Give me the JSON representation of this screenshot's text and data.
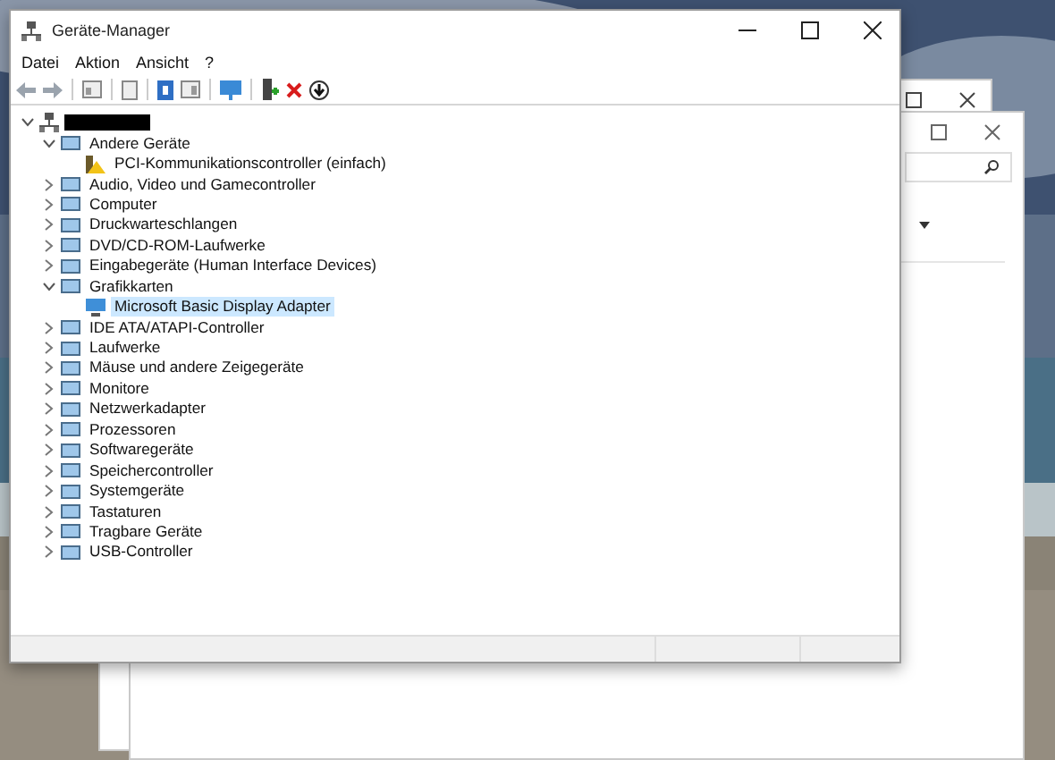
{
  "window": {
    "title": "Geräte-Manager"
  },
  "menu": [
    {
      "label": "Datei"
    },
    {
      "label": "Aktion"
    },
    {
      "label": "Ansicht"
    },
    {
      "label": "?"
    }
  ],
  "tree": [
    {
      "redacted": true,
      "expanded": true,
      "children": [
        {
          "label": "Andere Geräte",
          "expanded": true,
          "children": [
            {
              "label": "PCI-Kommunikationscontroller (einfach)",
              "warning": true,
              "selected": false
            }
          ],
          "selected": false
        },
        {
          "label": "Audio, Video und Gamecontroller",
          "expanded": false,
          "selected": false
        },
        {
          "label": "Computer",
          "expanded": false,
          "selected": false
        },
        {
          "label": "Druckwarteschlangen",
          "expanded": false,
          "selected": false
        },
        {
          "label": "DVD/CD-ROM-Laufwerke",
          "expanded": false,
          "selected": false
        },
        {
          "label": "Eingabegeräte (Human Interface Devices)",
          "expanded": false,
          "selected": false
        },
        {
          "label": "Grafikkarten",
          "expanded": true,
          "children": [
            {
              "label": "Microsoft Basic Display Adapter",
              "warning": false,
              "selected": true
            }
          ],
          "selected": false
        },
        {
          "label": "IDE ATA/ATAPI-Controller",
          "expanded": false,
          "selected": false
        },
        {
          "label": "Laufwerke",
          "expanded": false,
          "selected": false
        },
        {
          "label": "Mäuse und andere Zeigegeräte",
          "expanded": false,
          "selected": false
        },
        {
          "label": "Monitore",
          "expanded": false,
          "selected": false
        },
        {
          "label": "Netzwerkadapter",
          "expanded": false,
          "selected": false
        },
        {
          "label": "Prozessoren",
          "expanded": false,
          "selected": false
        },
        {
          "label": "Softwaregeräte",
          "expanded": false,
          "selected": false
        },
        {
          "label": "Speichercontroller",
          "expanded": false,
          "selected": false
        },
        {
          "label": "Systemgeräte",
          "expanded": false,
          "selected": false
        },
        {
          "label": "Tastaturen",
          "expanded": false,
          "selected": false
        },
        {
          "label": "Tragbare Geräte",
          "expanded": false,
          "selected": false
        },
        {
          "label": "USB-Controller",
          "expanded": false,
          "selected": false
        }
      ]
    }
  ]
}
